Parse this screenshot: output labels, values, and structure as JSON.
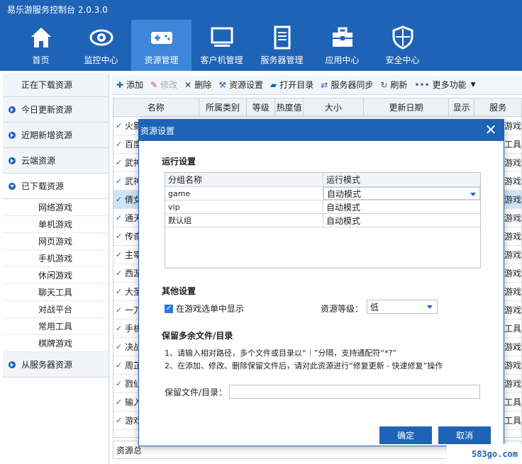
{
  "app": {
    "title": "易乐游服务控制台 2.0.3.0"
  },
  "nav": [
    {
      "label": "首页",
      "icon": "home-icon"
    },
    {
      "label": "监控中心",
      "icon": "eye-icon"
    },
    {
      "label": "资源管理",
      "icon": "gamepad-icon",
      "active": true
    },
    {
      "label": "客户机管理",
      "icon": "monitor-icon"
    },
    {
      "label": "服务器管理",
      "icon": "server-icon"
    },
    {
      "label": "应用中心",
      "icon": "toolbox-icon"
    },
    {
      "label": "安全中心",
      "icon": "shield-icon"
    }
  ],
  "sidebar": {
    "top": "正在下载资源",
    "items": [
      "今日更新资源",
      "近期新增资源",
      "云端资源",
      "已下载资源"
    ],
    "subitems": [
      "网络游戏",
      "单机游戏",
      "网页游戏",
      "手机游戏",
      "休闲游戏",
      "聊天工具",
      "对战平台",
      "常用工具",
      "棋牌游戏"
    ],
    "last": "从服务器资源"
  },
  "toolbar": {
    "add": "添加",
    "edit": "修改",
    "delete": "删除",
    "resource_settings": "资源设置",
    "open_dir": "打开目录",
    "server_sync": "服务器同步",
    "refresh": "刷新",
    "more": "更多功能"
  },
  "grid": {
    "headers": [
      "名称",
      "所属类别",
      "等级",
      "热度值",
      "大小",
      "更新日期",
      "显示",
      "服务"
    ],
    "rows": [
      {
        "name": "火影",
        "right": "游戏"
      },
      {
        "name": "百度",
        "right": "工具"
      },
      {
        "name": "武神",
        "right": "游戏"
      },
      {
        "name": "武神",
        "right": "游戏"
      },
      {
        "name": "倩女",
        "right": "游戏"
      },
      {
        "name": "通天",
        "right": "游戏"
      },
      {
        "name": "传奇",
        "right": "游戏"
      },
      {
        "name": "主宰",
        "right": "游戏"
      },
      {
        "name": "西游",
        "right": "游戏"
      },
      {
        "name": "大圣",
        "right": "游戏"
      },
      {
        "name": "一刀",
        "right": "游戏"
      },
      {
        "name": "手机",
        "right": "工具"
      },
      {
        "name": "决战",
        "right": "游戏"
      },
      {
        "name": "周芷",
        "right": "游戏"
      },
      {
        "name": "戮仙",
        "right": "游戏"
      },
      {
        "name": "输入",
        "right": "工具"
      },
      {
        "name": "游戏",
        "right": "工具"
      }
    ]
  },
  "statusbar": {
    "text": "资源总"
  },
  "dialog": {
    "title": "资源设置",
    "run_settings": "运行设置",
    "table_headers": [
      "分组名称",
      "运行模式"
    ],
    "table_rows": [
      {
        "group": "game",
        "mode": "自动模式"
      },
      {
        "group": "vip",
        "mode": "自动模式"
      },
      {
        "group": "默认组",
        "mode": "自动模式"
      }
    ],
    "other_settings": "其他设置",
    "show_in_menu": "在游戏选单中显示",
    "level_label": "资源等级：",
    "level_value": "低",
    "keep_title": "保留多余文件/目录",
    "note1": "1、请输入相对路径，多个文件或目录以“｜”分隔，支持通配符“*?”",
    "note2": "2、在添加、修改、删除保留文件后，请对此资源进行“修复更新 - 快速修复”操作",
    "keep_label": "保留文件/目录：",
    "keep_value": "",
    "ok": "确定",
    "cancel": "取消"
  },
  "watermark": {
    "text": "583go.com"
  }
}
